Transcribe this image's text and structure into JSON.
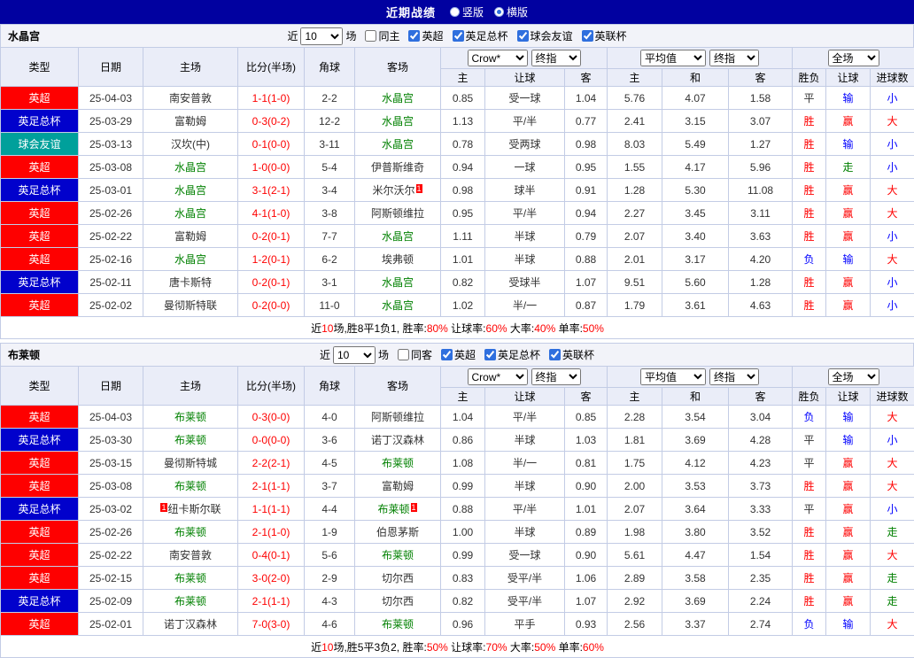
{
  "titlebar": {
    "title": "近期战绩",
    "radios": [
      {
        "label": "竖版",
        "selected": false
      },
      {
        "label": "横版",
        "selected": true
      }
    ]
  },
  "colors": {
    "titlebar_bg": "#0101a0",
    "league_badge": "#fe0000",
    "cup_badge": "#0101cc",
    "friendly_badge": "#00a09b",
    "focus_team_green": "#008000",
    "win_red": "#fe0000",
    "lose_blue": "#0000fe",
    "push_green": "#008000"
  },
  "filters_common": {
    "near_label": "近",
    "count": "10",
    "unit_label": "场"
  },
  "table_header": {
    "static": [
      "类型",
      "日期",
      "主场",
      "比分(半场)",
      "角球",
      "客场"
    ],
    "sub": [
      "主",
      "让球",
      "客",
      "主",
      "和",
      "客",
      "胜负",
      "让球",
      "进球数"
    ],
    "selects": {
      "company": "Crow*",
      "final_a": "终指",
      "average": "平均值",
      "final_b": "终指",
      "scope": "全场"
    }
  },
  "sections": [
    {
      "team": "水晶宫",
      "same_label": "同主",
      "same_checked": false,
      "leagues": [
        "英超",
        "英足总杯",
        "球会友谊",
        "英联杯"
      ],
      "rows": [
        {
          "t": "英超",
          "tc": "league",
          "d": "25-04-03",
          "h": {
            "n": "南安普敦"
          },
          "s": "1-1(1-0)",
          "c": "2-2",
          "a": {
            "n": "水晶宫",
            "g": true
          },
          "o1": [
            "0.85",
            "受一球",
            "1.04"
          ],
          "o2": [
            "5.76",
            "4.07",
            "1.58"
          ],
          "r": [
            [
              "平",
              "d"
            ],
            [
              "输",
              "l"
            ],
            [
              "小",
              "l"
            ]
          ]
        },
        {
          "t": "英足总杯",
          "tc": "cup",
          "d": "25-03-29",
          "h": {
            "n": "富勒姆"
          },
          "s": "0-3(0-2)",
          "c": "12-2",
          "a": {
            "n": "水晶宫",
            "g": true
          },
          "o1": [
            "1.13",
            "平/半",
            "0.77"
          ],
          "o2": [
            "2.41",
            "3.15",
            "3.07"
          ],
          "r": [
            [
              "胜",
              "w"
            ],
            [
              "赢",
              "w"
            ],
            [
              "大",
              "w"
            ]
          ]
        },
        {
          "t": "球会友谊",
          "tc": "friendly",
          "d": "25-03-13",
          "h": {
            "n": "汉坎(中)"
          },
          "s": "0-1(0-0)",
          "c": "3-11",
          "a": {
            "n": "水晶宫",
            "g": true
          },
          "o1": [
            "0.78",
            "受两球",
            "0.98"
          ],
          "o2": [
            "8.03",
            "5.49",
            "1.27"
          ],
          "r": [
            [
              "胜",
              "w"
            ],
            [
              "输",
              "l"
            ],
            [
              "小",
              "l"
            ]
          ]
        },
        {
          "t": "英超",
          "tc": "league",
          "d": "25-03-08",
          "h": {
            "n": "水晶宫",
            "g": true
          },
          "s": "1-0(0-0)",
          "c": "5-4",
          "a": {
            "n": "伊普斯维奇"
          },
          "o1": [
            "0.94",
            "一球",
            "0.95"
          ],
          "o2": [
            "1.55",
            "4.17",
            "5.96"
          ],
          "r": [
            [
              "胜",
              "w"
            ],
            [
              "走",
              "p"
            ],
            [
              "小",
              "l"
            ]
          ]
        },
        {
          "t": "英足总杯",
          "tc": "cup",
          "d": "25-03-01",
          "h": {
            "n": "水晶宫",
            "g": true
          },
          "s": "3-1(2-1)",
          "c": "3-4",
          "a": {
            "n": "米尔沃尔",
            "ba": "1"
          },
          "o1": [
            "0.98",
            "球半",
            "0.91"
          ],
          "o2": [
            "1.28",
            "5.30",
            "11.08"
          ],
          "r": [
            [
              "胜",
              "w"
            ],
            [
              "赢",
              "w"
            ],
            [
              "大",
              "w"
            ]
          ]
        },
        {
          "t": "英超",
          "tc": "league",
          "d": "25-02-26",
          "h": {
            "n": "水晶宫",
            "g": true
          },
          "s": "4-1(1-0)",
          "c": "3-8",
          "a": {
            "n": "阿斯顿维拉"
          },
          "o1": [
            "0.95",
            "平/半",
            "0.94"
          ],
          "o2": [
            "2.27",
            "3.45",
            "3.11"
          ],
          "r": [
            [
              "胜",
              "w"
            ],
            [
              "赢",
              "w"
            ],
            [
              "大",
              "w"
            ]
          ]
        },
        {
          "t": "英超",
          "tc": "league",
          "d": "25-02-22",
          "h": {
            "n": "富勒姆"
          },
          "s": "0-2(0-1)",
          "c": "7-7",
          "a": {
            "n": "水晶宫",
            "g": true
          },
          "o1": [
            "1.11",
            "半球",
            "0.79"
          ],
          "o2": [
            "2.07",
            "3.40",
            "3.63"
          ],
          "r": [
            [
              "胜",
              "w"
            ],
            [
              "赢",
              "w"
            ],
            [
              "小",
              "l"
            ]
          ]
        },
        {
          "t": "英超",
          "tc": "league",
          "d": "25-02-16",
          "h": {
            "n": "水晶宫",
            "g": true
          },
          "s": "1-2(0-1)",
          "c": "6-2",
          "a": {
            "n": "埃弗顿"
          },
          "o1": [
            "1.01",
            "半球",
            "0.88"
          ],
          "o2": [
            "2.01",
            "3.17",
            "4.20"
          ],
          "r": [
            [
              "负",
              "l"
            ],
            [
              "输",
              "l"
            ],
            [
              "大",
              "w"
            ]
          ]
        },
        {
          "t": "英足总杯",
          "tc": "cup",
          "d": "25-02-11",
          "h": {
            "n": "唐卡斯特"
          },
          "s": "0-2(0-1)",
          "c": "3-1",
          "a": {
            "n": "水晶宫",
            "g": true
          },
          "o1": [
            "0.82",
            "受球半",
            "1.07"
          ],
          "o2": [
            "9.51",
            "5.60",
            "1.28"
          ],
          "r": [
            [
              "胜",
              "w"
            ],
            [
              "赢",
              "w"
            ],
            [
              "小",
              "l"
            ]
          ]
        },
        {
          "t": "英超",
          "tc": "league",
          "d": "25-02-02",
          "h": {
            "n": "曼彻斯特联"
          },
          "s": "0-2(0-0)",
          "c": "11-0",
          "a": {
            "n": "水晶宫",
            "g": true
          },
          "o1": [
            "1.02",
            "半/一",
            "0.87"
          ],
          "o2": [
            "1.79",
            "3.61",
            "4.63"
          ],
          "r": [
            [
              "胜",
              "w"
            ],
            [
              "赢",
              "w"
            ],
            [
              "小",
              "l"
            ]
          ]
        }
      ],
      "summary": [
        {
          "text": "近"
        },
        {
          "text": "10",
          "red": true
        },
        {
          "text": "场,胜8平1负1, 胜率:"
        },
        {
          "text": "80%",
          "red": true
        },
        {
          "text": " 让球率:"
        },
        {
          "text": "60%",
          "red": true
        },
        {
          "text": " 大率:"
        },
        {
          "text": "40%",
          "red": true
        },
        {
          "text": " 单率:"
        },
        {
          "text": "50%",
          "red": true
        }
      ]
    },
    {
      "team": "布莱顿",
      "same_label": "同客",
      "same_checked": false,
      "leagues": [
        "英超",
        "英足总杯",
        "英联杯"
      ],
      "rows": [
        {
          "t": "英超",
          "tc": "league",
          "d": "25-04-03",
          "h": {
            "n": "布莱顿",
            "g": true
          },
          "s": "0-3(0-0)",
          "c": "4-0",
          "a": {
            "n": "阿斯顿维拉"
          },
          "o1": [
            "1.04",
            "平/半",
            "0.85"
          ],
          "o2": [
            "2.28",
            "3.54",
            "3.04"
          ],
          "r": [
            [
              "负",
              "l"
            ],
            [
              "输",
              "l"
            ],
            [
              "大",
              "w"
            ]
          ]
        },
        {
          "t": "英足总杯",
          "tc": "cup",
          "d": "25-03-30",
          "h": {
            "n": "布莱顿",
            "g": true
          },
          "s": "0-0(0-0)",
          "c": "3-6",
          "a": {
            "n": "诺丁汉森林"
          },
          "o1": [
            "0.86",
            "半球",
            "1.03"
          ],
          "o2": [
            "1.81",
            "3.69",
            "4.28"
          ],
          "r": [
            [
              "平",
              "d"
            ],
            [
              "输",
              "l"
            ],
            [
              "小",
              "l"
            ]
          ]
        },
        {
          "t": "英超",
          "tc": "league",
          "d": "25-03-15",
          "h": {
            "n": "曼彻斯特城"
          },
          "s": "2-2(2-1)",
          "c": "4-5",
          "a": {
            "n": "布莱顿",
            "g": true
          },
          "o1": [
            "1.08",
            "半/一",
            "0.81"
          ],
          "o2": [
            "1.75",
            "4.12",
            "4.23"
          ],
          "r": [
            [
              "平",
              "d"
            ],
            [
              "赢",
              "w"
            ],
            [
              "大",
              "w"
            ]
          ]
        },
        {
          "t": "英超",
          "tc": "league",
          "d": "25-03-08",
          "h": {
            "n": "布莱顿",
            "g": true
          },
          "s": "2-1(1-1)",
          "c": "3-7",
          "a": {
            "n": "富勒姆"
          },
          "o1": [
            "0.99",
            "半球",
            "0.90"
          ],
          "o2": [
            "2.00",
            "3.53",
            "3.73"
          ],
          "r": [
            [
              "胜",
              "w"
            ],
            [
              "赢",
              "w"
            ],
            [
              "大",
              "w"
            ]
          ]
        },
        {
          "t": "英足总杯",
          "tc": "cup",
          "d": "25-03-02",
          "h": {
            "n": "纽卡斯尔联",
            "bp": "1"
          },
          "s": "1-1(1-1)",
          "c": "4-4",
          "a": {
            "n": "布莱顿",
            "g": true,
            "ba": "1"
          },
          "o1": [
            "0.88",
            "平/半",
            "1.01"
          ],
          "o2": [
            "2.07",
            "3.64",
            "3.33"
          ],
          "r": [
            [
              "平",
              "d"
            ],
            [
              "赢",
              "w"
            ],
            [
              "小",
              "l"
            ]
          ]
        },
        {
          "t": "英超",
          "tc": "league",
          "d": "25-02-26",
          "h": {
            "n": "布莱顿",
            "g": true
          },
          "s": "2-1(1-0)",
          "c": "1-9",
          "a": {
            "n": "伯恩茅斯"
          },
          "o1": [
            "1.00",
            "半球",
            "0.89"
          ],
          "o2": [
            "1.98",
            "3.80",
            "3.52"
          ],
          "r": [
            [
              "胜",
              "w"
            ],
            [
              "赢",
              "w"
            ],
            [
              "走",
              "p"
            ]
          ]
        },
        {
          "t": "英超",
          "tc": "league",
          "d": "25-02-22",
          "h": {
            "n": "南安普敦"
          },
          "s": "0-4(0-1)",
          "c": "5-6",
          "a": {
            "n": "布莱顿",
            "g": true
          },
          "o1": [
            "0.99",
            "受一球",
            "0.90"
          ],
          "o2": [
            "5.61",
            "4.47",
            "1.54"
          ],
          "r": [
            [
              "胜",
              "w"
            ],
            [
              "赢",
              "w"
            ],
            [
              "大",
              "w"
            ]
          ]
        },
        {
          "t": "英超",
          "tc": "league",
          "d": "25-02-15",
          "h": {
            "n": "布莱顿",
            "g": true
          },
          "s": "3-0(2-0)",
          "c": "2-9",
          "a": {
            "n": "切尔西"
          },
          "o1": [
            "0.83",
            "受平/半",
            "1.06"
          ],
          "o2": [
            "2.89",
            "3.58",
            "2.35"
          ],
          "r": [
            [
              "胜",
              "w"
            ],
            [
              "赢",
              "w"
            ],
            [
              "走",
              "p"
            ]
          ]
        },
        {
          "t": "英足总杯",
          "tc": "cup",
          "d": "25-02-09",
          "h": {
            "n": "布莱顿",
            "g": true
          },
          "s": "2-1(1-1)",
          "c": "4-3",
          "a": {
            "n": "切尔西"
          },
          "o1": [
            "0.82",
            "受平/半",
            "1.07"
          ],
          "o2": [
            "2.92",
            "3.69",
            "2.24"
          ],
          "r": [
            [
              "胜",
              "w"
            ],
            [
              "赢",
              "w"
            ],
            [
              "走",
              "p"
            ]
          ]
        },
        {
          "t": "英超",
          "tc": "league",
          "d": "25-02-01",
          "h": {
            "n": "诺丁汉森林"
          },
          "s": "7-0(3-0)",
          "c": "4-6",
          "a": {
            "n": "布莱顿",
            "g": true
          },
          "o1": [
            "0.96",
            "平手",
            "0.93"
          ],
          "o2": [
            "2.56",
            "3.37",
            "2.74"
          ],
          "r": [
            [
              "负",
              "l"
            ],
            [
              "输",
              "l"
            ],
            [
              "大",
              "w"
            ]
          ]
        }
      ],
      "summary": [
        {
          "text": "近"
        },
        {
          "text": "10",
          "red": true
        },
        {
          "text": "场,胜5平3负2, 胜率:"
        },
        {
          "text": "50%",
          "red": true
        },
        {
          "text": " 让球率:"
        },
        {
          "text": "70%",
          "red": true
        },
        {
          "text": " 大率:"
        },
        {
          "text": "50%",
          "red": true
        },
        {
          "text": " 单率:"
        },
        {
          "text": "60%",
          "red": true
        }
      ]
    }
  ]
}
